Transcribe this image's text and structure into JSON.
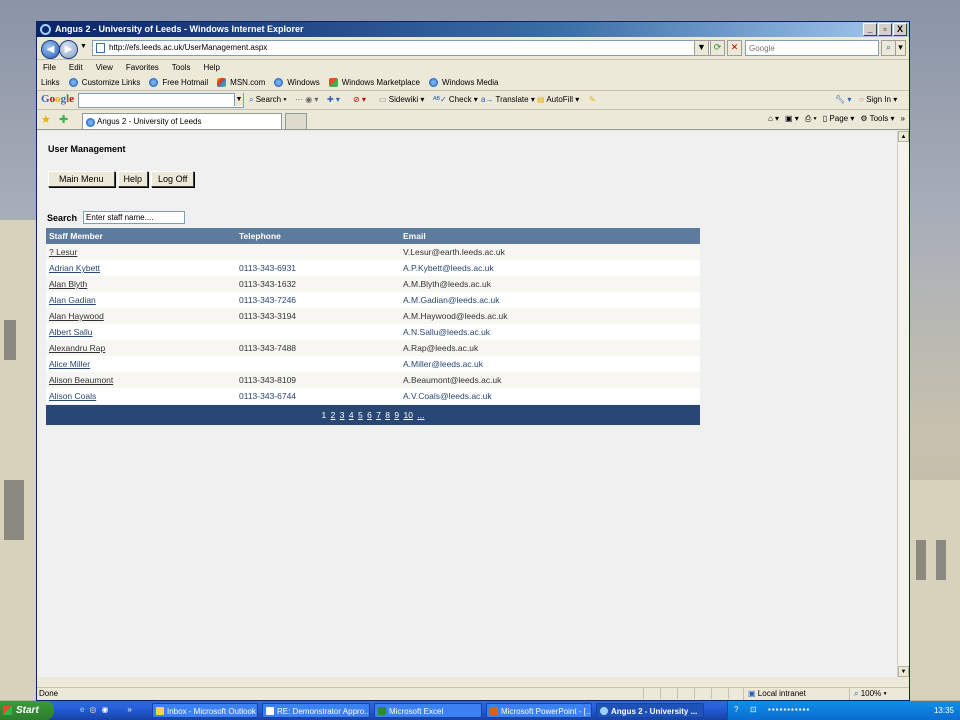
{
  "window": {
    "title": "Angus 2 - University of Leeds - Windows Internet Explorer",
    "controls": [
      "_",
      "▫",
      "X"
    ]
  },
  "address": {
    "url": "http://efs.leeds.ac.uk/UserManagement.aspx",
    "search_placeholder": "Google"
  },
  "menu": [
    "File",
    "Edit",
    "View",
    "Favorites",
    "Tools",
    "Help"
  ],
  "links": {
    "label": "Links",
    "items": [
      "Customize Links",
      "Free Hotmail",
      "MSN.com",
      "Windows",
      "Windows Marketplace",
      "Windows Media"
    ]
  },
  "googlebar": {
    "search": "Search",
    "sidewiki": "Sidewiki",
    "check": "Check",
    "translate": "Translate",
    "autofill": "AutoFill",
    "signin": "Sign In"
  },
  "tab": {
    "label": "Angus 2 - University of Leeds",
    "cmd": {
      "page": "Page",
      "tools": "Tools"
    }
  },
  "page": {
    "title": "User Management",
    "buttons": {
      "main_menu": "Main Menu",
      "help": "Help",
      "log_off": "Log Off"
    },
    "search": {
      "label": "Search",
      "value": "Enter staff name...."
    },
    "table": {
      "headers": [
        "Staff Member",
        "Telephone",
        "Email"
      ],
      "rows": [
        {
          "name": "? Lesur",
          "phone": "",
          "email": "V.Lesur@earth.leeds.ac.uk"
        },
        {
          "name": "Adrian Kybett",
          "phone": "0113-343-6931",
          "email": "A.P.Kybett@leeds.ac.uk"
        },
        {
          "name": "Alan Blyth",
          "phone": "0113-343-1632",
          "email": "A.M.Blyth@leeds.ac.uk"
        },
        {
          "name": "Alan Gadian",
          "phone": "0113-343-7246",
          "email": "A.M.Gadian@leeds.ac.uk"
        },
        {
          "name": "Alan Haywood",
          "phone": "0113-343-3194",
          "email": "A.M.Haywood@leeds.ac.uk"
        },
        {
          "name": "Albert Sallu",
          "phone": "",
          "email": "A.N.Sallu@leeds.ac.uk"
        },
        {
          "name": "Alexandru Rap",
          "phone": "0113-343-7488",
          "email": "A.Rap@leeds.ac.uk"
        },
        {
          "name": "Alice Miller",
          "phone": "",
          "email": "A.Miller@leeds.ac.uk"
        },
        {
          "name": "Alison Beaumont",
          "phone": "0113-343-8109",
          "email": "A.Beaumont@leeds.ac.uk"
        },
        {
          "name": "Alison Coals",
          "phone": "0113-343-6744",
          "email": "A.V.Coals@leeds.ac.uk"
        }
      ],
      "pager": [
        "1",
        "2",
        "3",
        "4",
        "5",
        "6",
        "7",
        "8",
        "9",
        "10",
        "..."
      ]
    }
  },
  "status": {
    "text": "Done",
    "zone": "Local intranet",
    "zoom": "100%"
  },
  "taskbar": {
    "start": "Start",
    "tasks": [
      "Inbox - Microsoft Outlook",
      "RE: Demonstrator Appro...",
      "Microsoft Excel",
      "Microsoft PowerPoint - [...",
      "Angus 2 - University ..."
    ],
    "clock": "13:35"
  }
}
